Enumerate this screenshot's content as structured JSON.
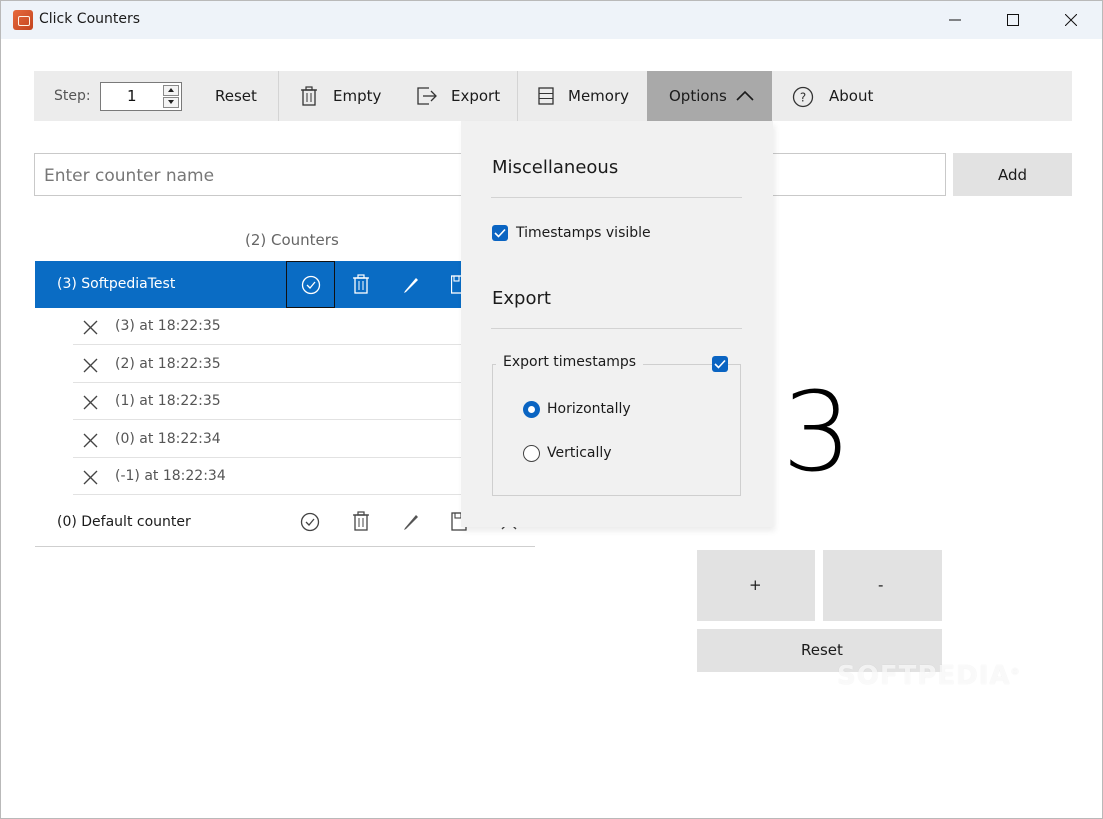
{
  "window": {
    "title": "Click Counters"
  },
  "toolbar": {
    "step_label": "Step:",
    "step_value": "1",
    "reset_label": "Reset",
    "empty_label": "Empty",
    "export_label": "Export",
    "memory_label": "Memory",
    "options_label": "Options",
    "about_label": "About"
  },
  "counter_input": {
    "placeholder": "Enter counter name",
    "add_label": "Add"
  },
  "counters": {
    "header": "(2) Counters",
    "selected": {
      "name": "(3) SoftpediaTest",
      "timestamps": [
        "(3) at 18:22:35",
        "(2) at 18:22:35",
        "(1) at 18:22:35",
        "(0) at 18:22:34",
        "(-1) at 18:22:34"
      ]
    },
    "other": {
      "name": "(0) Default counter"
    }
  },
  "display": {
    "value": "3",
    "plus_label": "+",
    "minus_label": "-",
    "reset_label": "Reset"
  },
  "options_menu": {
    "misc_title": "Miscellaneous",
    "timestamps_visible_label": "Timestamps visible",
    "timestamps_visible_checked": true,
    "export_title": "Export",
    "export_timestamps_label": "Export timestamps",
    "export_timestamps_checked": true,
    "orientation_options": [
      "Horizontally",
      "Vertically"
    ],
    "orientation_selected": "Horizontally"
  },
  "watermark": "SOFTPEDIA",
  "colors": {
    "accent": "#0a6cc4",
    "toolbar_bg": "#ececec",
    "options_active": "#a9a9a9"
  }
}
